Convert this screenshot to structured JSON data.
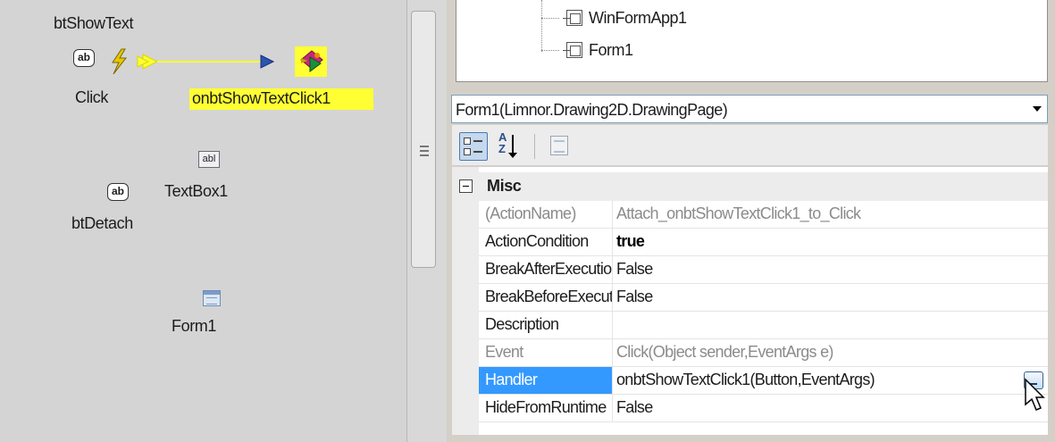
{
  "designer": {
    "button_show": {
      "name": "btShowText",
      "icon_text": "ab"
    },
    "event": {
      "label": "Click"
    },
    "handler": {
      "label": "onbtShowTextClick1"
    },
    "textbox": {
      "name": "TextBox1",
      "icon_text": "abl"
    },
    "button_detach": {
      "name": "btDetach",
      "icon_text": "ab"
    },
    "form": {
      "name": "Form1"
    },
    "colors": {
      "highlight": "#ffff33",
      "canvas": "#d4d4d4"
    }
  },
  "tree": {
    "items": [
      {
        "label": "WinFormApp1"
      },
      {
        "label": "Form1"
      }
    ]
  },
  "property_grid": {
    "object_selector": "Form1(Limnor.Drawing2D.DrawingPage)",
    "toolbar": {
      "categorized": "categorized-icon",
      "alphabetical": "sort-alphabetical-icon",
      "alphabetical_letters": [
        "A",
        "Z"
      ],
      "property_pages": "property-pages-icon"
    },
    "category": "Misc",
    "rows": [
      {
        "name": "(ActionName)",
        "value": "Attach_onbtShowTextClick1_to_Click",
        "readonly": true
      },
      {
        "name": "ActionCondition",
        "value": "true",
        "bold": true
      },
      {
        "name": "BreakAfterExecution",
        "value": "False"
      },
      {
        "name": "BreakBeforeExecution",
        "value": "False"
      },
      {
        "name": "Description",
        "value": ""
      },
      {
        "name": "Event",
        "value": "Click(Object sender,EventArgs e)",
        "readonly": true
      },
      {
        "name": "Handler",
        "value": "onbtShowTextClick1(Button,EventArgs)",
        "selected": true
      },
      {
        "name": "HideFromRuntime",
        "value": "False"
      }
    ],
    "colors": {
      "selection": "#3399ff",
      "readonly_text": "#8b8b8b"
    }
  }
}
